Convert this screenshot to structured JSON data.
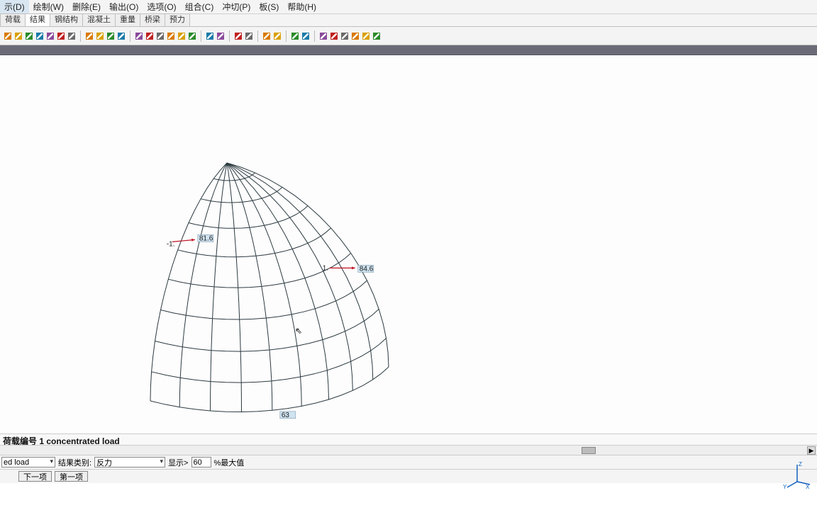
{
  "menu": {
    "items": [
      {
        "label": "示(D)"
      },
      {
        "label": "绘制(W)"
      },
      {
        "label": "删除(E)"
      },
      {
        "label": "输出(O)"
      },
      {
        "label": "选项(O)"
      },
      {
        "label": "组合(C)"
      },
      {
        "label": "冲切(P)"
      },
      {
        "label": "板(S)"
      },
      {
        "label": "帮助(H)"
      }
    ]
  },
  "tabs": {
    "items": [
      {
        "label": "荷载",
        "active": false
      },
      {
        "label": "结果",
        "active": true
      },
      {
        "label": "钢结构",
        "active": false
      },
      {
        "label": "混凝土",
        "active": false
      },
      {
        "label": "重量",
        "active": false
      },
      {
        "label": "桥梁",
        "active": false
      },
      {
        "label": "预力",
        "active": false
      }
    ]
  },
  "status": {
    "text": "荷载编号 1  concentrated load"
  },
  "controlbar": {
    "select1": "ed load",
    "label1": "结果类别:",
    "select2": "反力",
    "label2": "显示>",
    "numbox": "60",
    "label3": "%最大值"
  },
  "buttons": {
    "prev": "下一项",
    "next": "第一项"
  },
  "annotations": {
    "load_left_num": "1.",
    "load_left_node": "84.6",
    "load_top_num": "-1.",
    "load_top_node": "81.6",
    "bottom_node": "63"
  },
  "axis": {
    "x": "X",
    "y": "Y",
    "z": "Z"
  },
  "toolbar_icons": [
    "tool-1",
    "tool-2",
    "tool-3",
    "tool-4",
    "tool-5",
    "tool-6",
    "tool-7",
    "sep",
    "tool-8",
    "tool-9",
    "tool-10",
    "tool-11",
    "sep",
    "tool-12",
    "tool-13",
    "tool-14",
    "tool-15",
    "tool-16",
    "tool-17",
    "sep",
    "tool-18",
    "tool-19",
    "sep",
    "tool-20",
    "tool-21",
    "sep",
    "tool-22",
    "tool-23",
    "sep",
    "tool-24",
    "tool-25",
    "sep",
    "tool-26",
    "tool-27",
    "tool-28",
    "tool-29",
    "tool-30",
    "tool-31"
  ]
}
